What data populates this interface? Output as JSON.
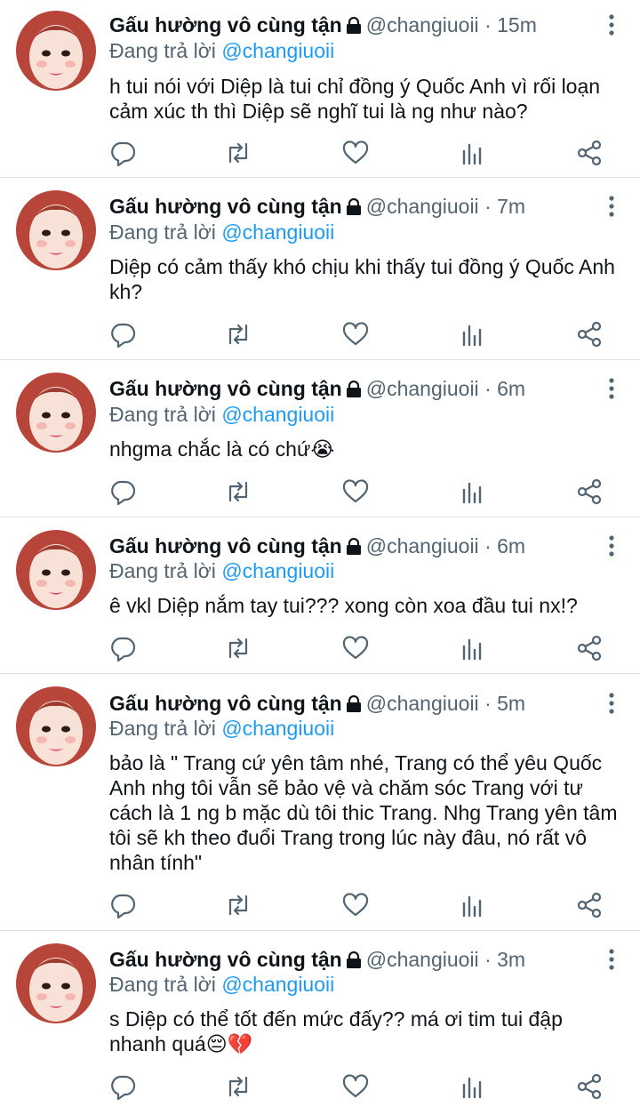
{
  "author": {
    "name": "Gấu hường vô cùng tận",
    "handle": "@changiuoii"
  },
  "reply_prefix": "Đang trả lời",
  "reply_handle": "@changiuoii",
  "separator": "·",
  "icons": {
    "lock": "lock-icon",
    "more": "more-vertical-icon",
    "reply": "reply-icon",
    "retweet": "retweet-icon",
    "like": "heart-icon",
    "views": "analytics-icon",
    "share": "share-icon"
  },
  "colors": {
    "link": "#1d9bf0",
    "secondary": "#536471",
    "primary": "#0f1419",
    "divider": "#dfe3e6"
  },
  "tweets": [
    {
      "time": "15m",
      "text": "h tui nói với Diệp là tui chỉ đồng ý Quốc Anh vì rối loạn cảm xúc th thì Diệp sẽ nghĩ tui là ng như nào?"
    },
    {
      "time": "7m",
      "text": "Diệp có cảm thấy khó chịu khi thấy tui đồng ý Quốc Anh kh?"
    },
    {
      "time": "6m",
      "text": "nhgma chắc là có chứ😭"
    },
    {
      "time": "6m",
      "text": "ê vkl Diệp nắm tay tui??? xong còn xoa đầu tui nx!?"
    },
    {
      "time": "5m",
      "text": "bảo là \" Trang cứ yên tâm nhé, Trang có thể yêu Quốc Anh nhg tôi vẫn sẽ bảo vệ và chăm sóc Trang với tư cách là 1 ng b mặc dù tôi thic Trang. Nhg Trang yên tâm tôi sẽ kh theo đuổi Trang trong lúc này đâu, nó rất vô nhân tính\""
    },
    {
      "time": "3m",
      "text": "s Diệp có thể tốt đến mức đấy?? má ơi tim tui đập nhanh quá😔💔"
    }
  ]
}
